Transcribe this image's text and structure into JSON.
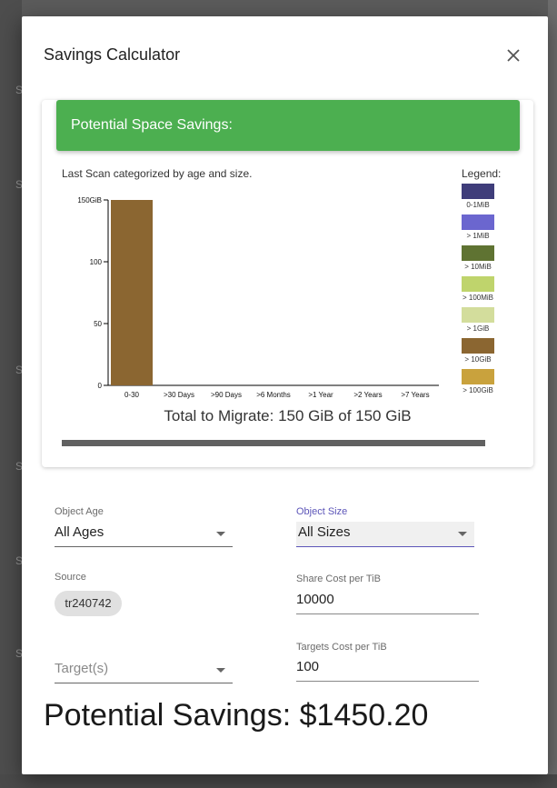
{
  "dialog": {
    "title": "Savings Calculator",
    "close_icon": "close-icon"
  },
  "card": {
    "header": "Potential Space Savings:",
    "caption": "Last Scan categorized by age and size.",
    "legend_title": "Legend:",
    "legend": [
      {
        "label": "0-1MiB",
        "color": "#3f3d7a"
      },
      {
        "label": "> 1MiB",
        "color": "#6b66cf"
      },
      {
        "label": "> 10MiB",
        "color": "#5f7332"
      },
      {
        "label": "> 100MiB",
        "color": "#bfd46c"
      },
      {
        "label": "> 1GiB",
        "color": "#d3dd9c"
      },
      {
        "label": "> 10GiB",
        "color": "#8b6631"
      },
      {
        "label": "> 100GiB",
        "color": "#c9a23d"
      }
    ],
    "total": "Total to Migrate: 150 GiB of 150 GiB",
    "progress": 1.0
  },
  "chart_data": {
    "type": "bar",
    "categories": [
      "0-30",
      ">30 Days",
      ">90 Days",
      ">6 Months",
      ">1 Year",
      ">2 Years",
      ">7 Years"
    ],
    "series": [
      {
        "name": "> 10GiB",
        "values": [
          150,
          0,
          0,
          0,
          0,
          0,
          0
        ],
        "color": "#8b6631"
      }
    ],
    "yticks": [
      "0",
      "50",
      "100",
      "150GiB"
    ],
    "ytick_values": [
      0,
      50,
      100,
      150
    ],
    "ylim": [
      0,
      150
    ],
    "title": "",
    "xlabel": "",
    "ylabel": ""
  },
  "form": {
    "object_age": {
      "label": "Object Age",
      "value": "All Ages"
    },
    "object_size": {
      "label": "Object Size",
      "value": "All Sizes"
    },
    "source": {
      "label": "Source",
      "chip": "tr240742"
    },
    "share_cost": {
      "label": "Share Cost per TiB",
      "value": "10000"
    },
    "targets": {
      "placeholder": "Target(s)"
    },
    "targets_cost": {
      "label": "Targets Cost per TiB",
      "value": "100"
    }
  },
  "savings": "Potential Savings: $1450.20",
  "backdrop": {
    "ghost_letters": [
      "S",
      "S",
      "S",
      "S",
      "S",
      "S"
    ]
  }
}
